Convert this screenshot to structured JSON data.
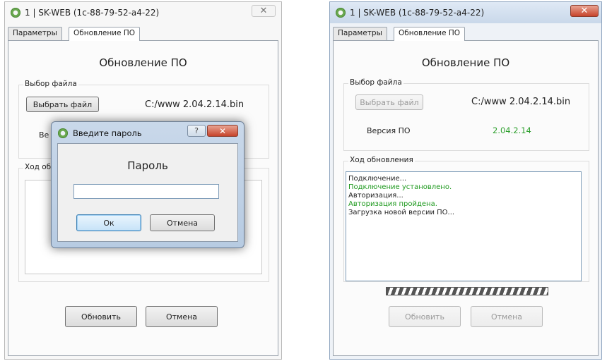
{
  "left_window": {
    "title": "1  |  SK-WEB (1c-88-79-52-a4-22)",
    "close_icon": "close-icon",
    "tabs": [
      {
        "label": "Параметры"
      },
      {
        "label": "Обновление ПО"
      }
    ],
    "heading": "Обновление ПО",
    "file_group": {
      "label": "Выбор файла",
      "choose_button": "Выбрать файл",
      "filename": "C:/www 2.04.2.14.bin",
      "version_label_partial": "Ве"
    },
    "progress_group": {
      "label_partial": "Ход об"
    },
    "update_button": "Обновить",
    "cancel_button": "Отмена"
  },
  "password_dialog": {
    "title": "Введите пароль",
    "help_icon": "help-icon",
    "close_icon": "close-icon",
    "heading": "Пароль",
    "password_value": "",
    "ok_button": "Ок",
    "cancel_button": "Отмена"
  },
  "right_window": {
    "title": "1  |  SK-WEB (1c-88-79-52-a4-22)",
    "close_icon": "close-icon",
    "tabs": [
      {
        "label": "Параметры"
      },
      {
        "label": "Обновление ПО"
      }
    ],
    "heading": "Обновление ПО",
    "file_group": {
      "label": "Выбор файла",
      "choose_button": "Выбрать файл",
      "filename": "C:/www 2.04.2.14.bin",
      "version_label": "Версия ПО",
      "version_value": "2.04.2.14"
    },
    "progress_group": {
      "label": "Ход обновления",
      "log": [
        {
          "text": "Подключение...",
          "status": "info"
        },
        {
          "text": "Подключение установлено.",
          "status": "ok"
        },
        {
          "text": "Авторизация...",
          "status": "info"
        },
        {
          "text": "Авторизация пройдена.",
          "status": "ok"
        },
        {
          "text": "Загрузка новой версии ПО...",
          "status": "info"
        }
      ]
    },
    "update_button": "Обновить",
    "cancel_button": "Отмена"
  },
  "colors": {
    "success": "#1f9a1f",
    "close_red": "#c7432b",
    "title_blue": "#c9d8ea"
  }
}
